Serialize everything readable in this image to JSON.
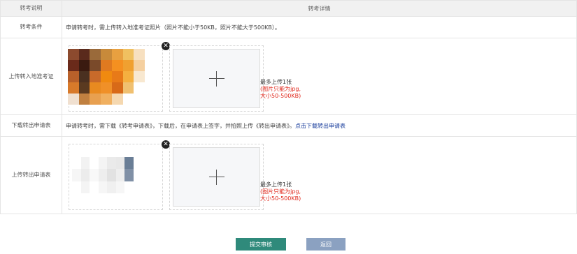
{
  "table": {
    "header_left": "转考说明",
    "header_right": "转考详情"
  },
  "rows": {
    "condition": {
      "label": "转考条件",
      "text": "申请转考时，需上传转入地准考证照片（照片不能小于50KB，照片不能大于500KB）。"
    },
    "upload_admission": {
      "label": "上传转入地准考证",
      "hint_count": "最多上传1张",
      "hint_format": "(图片只能为jpg,",
      "hint_size": "大小50-500KB)"
    },
    "download_form": {
      "label": "下载转出申请表",
      "text": "申请转考时，需下载《转考申请表》，下载后，在申请表上签字，并拍照上传《转出申请表》。",
      "link": "点击下载转出申请表"
    },
    "upload_form": {
      "label": "上传转出申请表",
      "hint_count": "最多上传1张",
      "hint_format": "(图片只能为jpg,",
      "hint_size": "大小50-500KB)"
    }
  },
  "buttons": {
    "submit": "提交审核",
    "back": "返回"
  },
  "icons": {
    "remove": "close-icon",
    "add": "plus-icon"
  },
  "colors": {
    "submit_bg": "#2f8a7b",
    "back_bg": "#8ba1c1",
    "hint_red": "#e0261a",
    "link_blue": "#1a3e9c"
  }
}
